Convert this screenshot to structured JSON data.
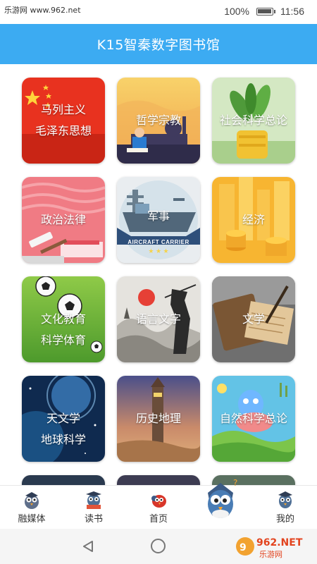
{
  "status_bar": {
    "watermark": "乐游网 www.962.net",
    "battery": "100%",
    "battery_level": 1.0,
    "time": "11:56"
  },
  "header": {
    "title": "K15智秦数字图书馆"
  },
  "categories": [
    {
      "line1": "马列主义",
      "line2": "毛泽东思想",
      "icon": "red-flag-stars"
    },
    {
      "line1": "哲学宗教",
      "line2": "",
      "icon": "mosque-reader"
    },
    {
      "line1": "社会科学总论",
      "line2": "",
      "icon": "potted-plant"
    },
    {
      "line1": "政治法律",
      "line2": "",
      "icon": "gavel-book"
    },
    {
      "line1": "军事",
      "line2": "",
      "icon": "aircraft-carrier",
      "badge": "AIRCRAFT CARRIER"
    },
    {
      "line1": "经济",
      "line2": "",
      "icon": "coins-buildings"
    },
    {
      "line1": "文化教育",
      "line2": "科学体育",
      "icon": "soccer-balls"
    },
    {
      "line1": "语言文字",
      "line2": "",
      "icon": "ink-samurai"
    },
    {
      "line1": "文学",
      "line2": "",
      "icon": "ancient-books"
    },
    {
      "line1": "天文学",
      "line2": "地球科学",
      "icon": "planet-space"
    },
    {
      "line1": "历史地理",
      "line2": "",
      "icon": "lighthouse"
    },
    {
      "line1": "自然科学总论",
      "line2": "",
      "icon": "cartoon-nature"
    }
  ],
  "bottom_nav": [
    {
      "label": "融媒体",
      "icon": "owl-media-icon"
    },
    {
      "label": "读书",
      "icon": "owl-book-icon"
    },
    {
      "label": "首页",
      "icon": "bird-home-icon"
    },
    {
      "label": "",
      "icon": "owl-mascot-icon"
    },
    {
      "label": "我的",
      "icon": "owl-profile-icon"
    }
  ],
  "system_nav": {
    "brand": "962.NET",
    "brand_sub": "乐游网"
  },
  "colors": {
    "header": "#3cabf2",
    "accent": "#3cabf2"
  }
}
